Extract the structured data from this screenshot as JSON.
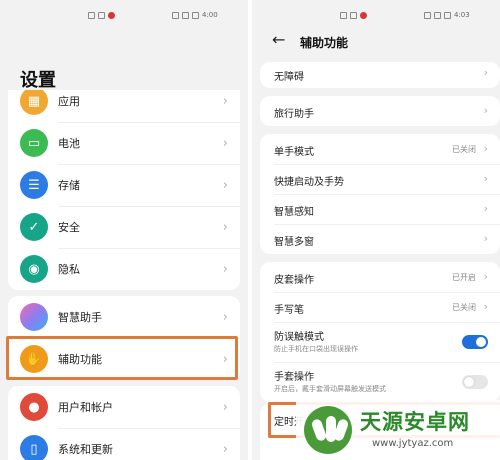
{
  "left": {
    "status": {
      "time": "4:00"
    },
    "title": "设置",
    "items_top": [
      {
        "label": "应用",
        "color": "#f0a830",
        "icon": "apps-icon"
      },
      {
        "label": "电池",
        "color": "#3cba54",
        "icon": "battery-icon"
      },
      {
        "label": "存储",
        "color": "#2d7be5",
        "icon": "storage-icon"
      },
      {
        "label": "安全",
        "color": "#17a589",
        "icon": "shield-icon"
      },
      {
        "label": "隐私",
        "color": "#17a589",
        "icon": "privacy-icon"
      }
    ],
    "items_mid": [
      {
        "label": "智慧助手",
        "color": "#8e7cf0",
        "icon": "assistant-icon"
      },
      {
        "label": "辅助功能",
        "color": "#f09a1a",
        "icon": "hand-icon"
      }
    ],
    "items_bottom": [
      {
        "label": "用户和帐户",
        "color": "#e04a3a",
        "icon": "user-icon"
      },
      {
        "label": "系统和更新",
        "color": "#2d7be5",
        "icon": "phone-icon"
      }
    ]
  },
  "right": {
    "status": {
      "time": "4:03"
    },
    "title": "辅助功能",
    "group1": [
      {
        "label": "无障碍"
      }
    ],
    "group2": [
      {
        "label": "旅行助手"
      }
    ],
    "group3": [
      {
        "label": "单手模式",
        "value": "已关闭"
      },
      {
        "label": "快捷启动及手势"
      },
      {
        "label": "智慧感知"
      },
      {
        "label": "智慧多窗"
      }
    ],
    "group4": [
      {
        "label": "皮套操作",
        "value": "已开启"
      },
      {
        "label": "手写笔",
        "value": "已关闭"
      },
      {
        "label": "防误触模式",
        "sub": "防止手机在口袋出现误操作",
        "toggle": true
      },
      {
        "label": "手套操作",
        "sub": "开启后，戴手套滑动屏幕触发送模式",
        "toggle": false
      }
    ],
    "timed_switch": "定时开",
    "watermark": {
      "text": "天源安卓网",
      "url": "www.jytyaz.com"
    }
  }
}
